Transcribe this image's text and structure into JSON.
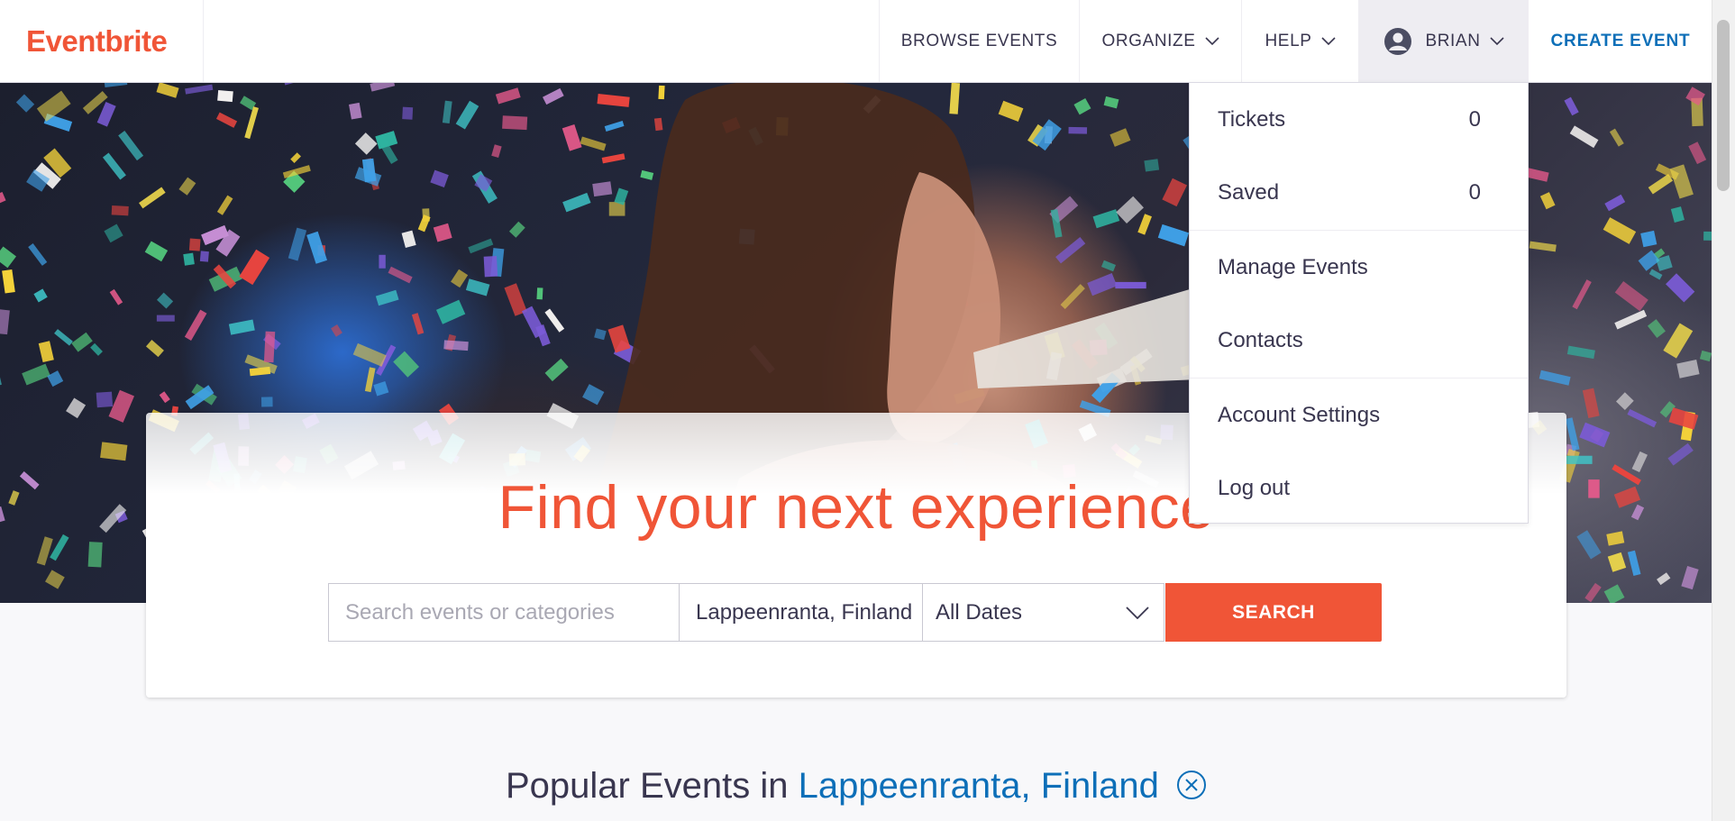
{
  "header": {
    "logo": "Eventbrite",
    "nav": {
      "browse_events": "BROWSE EVENTS",
      "organize": "ORGANIZE",
      "help": "HELP",
      "user": "BRIAN",
      "create_event": "CREATE EVENT"
    }
  },
  "dropdown": {
    "items": [
      {
        "label": "Tickets",
        "count": "0"
      },
      {
        "label": "Saved",
        "count": "0"
      },
      {
        "label": "Manage Events"
      },
      {
        "label": "Contacts"
      },
      {
        "label": "Account Settings"
      },
      {
        "label": "Log out"
      }
    ]
  },
  "hero": {
    "title": "Find your next experience",
    "search": {
      "query_placeholder": "Search events or categories",
      "location_value": "Lappeenranta, Finland",
      "dates_value": "All Dates",
      "button_label": "SEARCH"
    }
  },
  "popular": {
    "prefix": "Popular Events in",
    "location": "Lappeenranta, Finland"
  },
  "colors": {
    "brand_orange": "#f05537",
    "link_blue": "#0d6fb8",
    "text_dark": "#39364f"
  },
  "icons": [
    "chevron-down-icon",
    "user-avatar-icon",
    "close-circle-icon"
  ]
}
